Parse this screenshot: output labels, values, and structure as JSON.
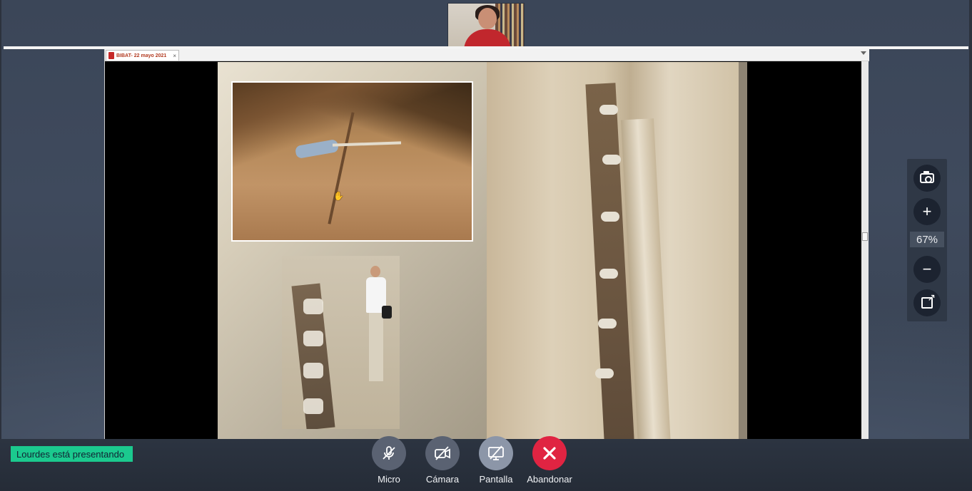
{
  "document_tab": {
    "title": "BIBAT- 22 mayo 2021",
    "close_glyph": "×"
  },
  "zoom": {
    "level": "67%",
    "zoom_in_glyph": "+",
    "zoom_out_glyph": "−"
  },
  "presenting_status": "Lourdes está presentando",
  "controls": [
    {
      "label": "Micro",
      "icon": "mic-off-icon",
      "state": "muted"
    },
    {
      "label": "Cámara",
      "icon": "camera-off-icon",
      "state": "off"
    },
    {
      "label": "Pantalla",
      "icon": "screen-share-off-icon",
      "state": "active"
    },
    {
      "label": "Abandonar",
      "icon": "close-icon",
      "state": "leave"
    }
  ],
  "colors": {
    "presenting_badge": "#1bc98e",
    "leave_button": "#e02442",
    "control_button": "#5a6272",
    "share_button": "#8c96a8",
    "background": "#3b4658"
  }
}
